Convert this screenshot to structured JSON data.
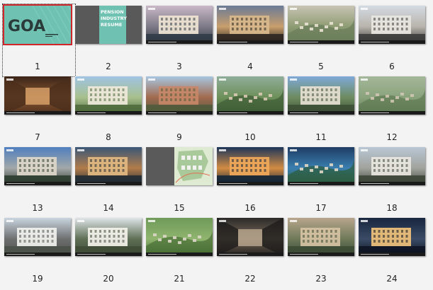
{
  "slides": [
    {
      "number": "1",
      "kind": "title",
      "title": "GOA",
      "selected": true
    },
    {
      "number": "2",
      "kind": "text",
      "lines": [
        "PENSION",
        "INDUSTRY",
        "RESUME"
      ]
    },
    {
      "number": "3",
      "kind": "photo",
      "sky": "#c9b7c8",
      "mid": "#7d7a86",
      "ground": "#2f3a45",
      "build": "#efe4d2"
    },
    {
      "number": "4",
      "kind": "photo",
      "sky": "#6a7b96",
      "mid": "#c89e6c",
      "ground": "#2a2520",
      "build": "#d8b98c"
    },
    {
      "number": "5",
      "kind": "aerial",
      "sky": "#c8c4b4",
      "mid": "#8e9c73",
      "ground": "#6a7d5a",
      "build": "#e8e2d2"
    },
    {
      "number": "6",
      "kind": "photo",
      "sky": "#d4dbe3",
      "mid": "#b8b4ad",
      "ground": "#3a3a3a",
      "build": "#e8e6e0"
    },
    {
      "number": "7",
      "kind": "interior",
      "sky": "#3a2418",
      "mid": "#8c5a33",
      "ground": "#4b2e1c",
      "build": "#d9a26a"
    },
    {
      "number": "8",
      "kind": "photo",
      "sky": "#9fc4e3",
      "mid": "#a8c08d",
      "ground": "#4d6a3c",
      "build": "#efe8da"
    },
    {
      "number": "9",
      "kind": "photo",
      "sky": "#a7c6e0",
      "mid": "#a26a4f",
      "ground": "#4f5a3c",
      "build": "#c58767"
    },
    {
      "number": "10",
      "kind": "aerial",
      "sky": "#8fae9a",
      "mid": "#6d9059",
      "ground": "#3f5d36",
      "build": "#d8c9b4"
    },
    {
      "number": "11",
      "kind": "photo",
      "sky": "#7fa9d9",
      "mid": "#6d8c5f",
      "ground": "#3c4f35",
      "build": "#e6dfd2"
    },
    {
      "number": "12",
      "kind": "aerial",
      "sky": "#a4b79a",
      "mid": "#8aa37c",
      "ground": "#5f7b54",
      "build": "#cfc5b2"
    },
    {
      "number": "13",
      "kind": "photo",
      "sky": "#4f7fbf",
      "mid": "#a3a7a8",
      "ground": "#2c3b2e",
      "build": "#ddd7c9"
    },
    {
      "number": "14",
      "kind": "photo",
      "sky": "#3a5778",
      "mid": "#b27c4a",
      "ground": "#1d2a34",
      "build": "#e2b981"
    },
    {
      "number": "15",
      "kind": "plan",
      "sky": "#5a5a5a",
      "mid": "#dfead3",
      "ground": "#9cc18d",
      "build": "#f2f2f2"
    },
    {
      "number": "16",
      "kind": "photo",
      "sky": "#1c3559",
      "mid": "#d28c43",
      "ground": "#0f2336",
      "build": "#f0a85a"
    },
    {
      "number": "17",
      "kind": "aerial",
      "sky": "#1f3c63",
      "mid": "#3a7fb0",
      "ground": "#2c5d3a",
      "build": "#e0d7c4"
    },
    {
      "number": "18",
      "kind": "photo",
      "sky": "#b9c7d4",
      "mid": "#a1a39d",
      "ground": "#3b4436",
      "build": "#e9e6df"
    },
    {
      "number": "19",
      "kind": "photo",
      "sky": "#c9d5df",
      "mid": "#6e6f70",
      "ground": "#4a5148",
      "build": "#f2f2ef"
    },
    {
      "number": "20",
      "kind": "photo",
      "sky": "#e0e5e8",
      "mid": "#5e6f55",
      "ground": "#3f4b36",
      "build": "#f4f2ec"
    },
    {
      "number": "21",
      "kind": "aerial",
      "sky": "#6f9a58",
      "mid": "#8fb56f",
      "ground": "#486d35",
      "build": "#dcd6c8"
    },
    {
      "number": "22",
      "kind": "interior",
      "sky": "#2b2a28",
      "mid": "#7a6a5a",
      "ground": "#1e1d1b",
      "build": "#b9a88f"
    },
    {
      "number": "23",
      "kind": "photo",
      "sky": "#b8a58c",
      "mid": "#6f7a5b",
      "ground": "#3b4a33",
      "build": "#d6c2a3"
    },
    {
      "number": "24",
      "kind": "photo",
      "sky": "#18263e",
      "mid": "#3b4b66",
      "ground": "#0d1422",
      "build": "#f0c27a"
    }
  ],
  "colors": {
    "selection": "#d0252b",
    "title_bg": "#6fc2b2",
    "title_text": "#2a3b3a",
    "text_slide_bg": "#595959",
    "text_slide_panel": "#6fc2b2"
  }
}
